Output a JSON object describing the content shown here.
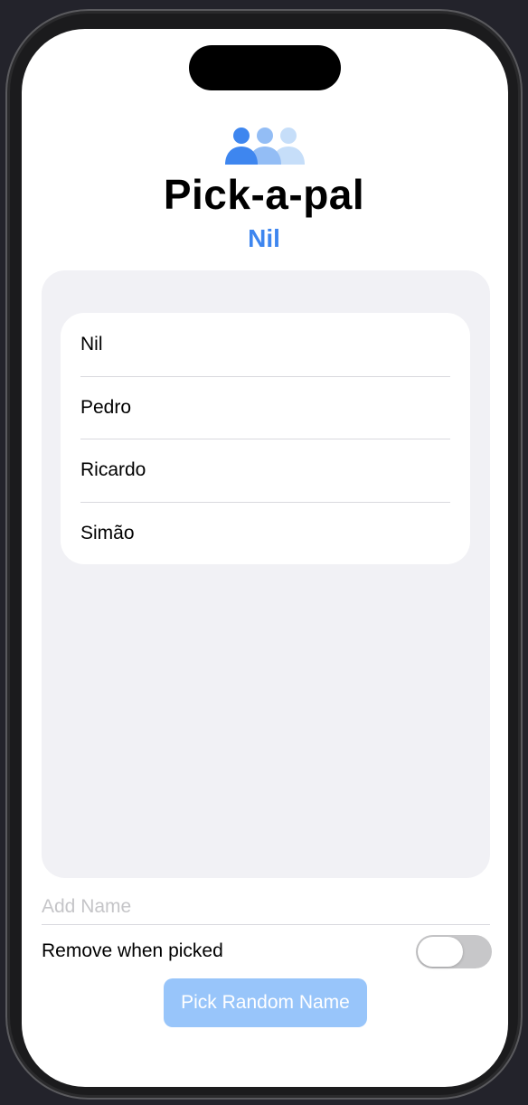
{
  "app": {
    "title": "Pick-a-pal",
    "picked_name": "Nil",
    "header_icon": "person-3-fill-icon",
    "accent_color": "#3e86ef"
  },
  "names_list": {
    "items": [
      "Nil",
      "Pedro",
      "Ricardo",
      "Simão"
    ]
  },
  "add_name": {
    "placeholder": "Add Name",
    "value": ""
  },
  "remove_toggle": {
    "label": "Remove when picked",
    "is_on": false
  },
  "pick_button": {
    "label": "Pick Random Name",
    "enabled": false
  }
}
